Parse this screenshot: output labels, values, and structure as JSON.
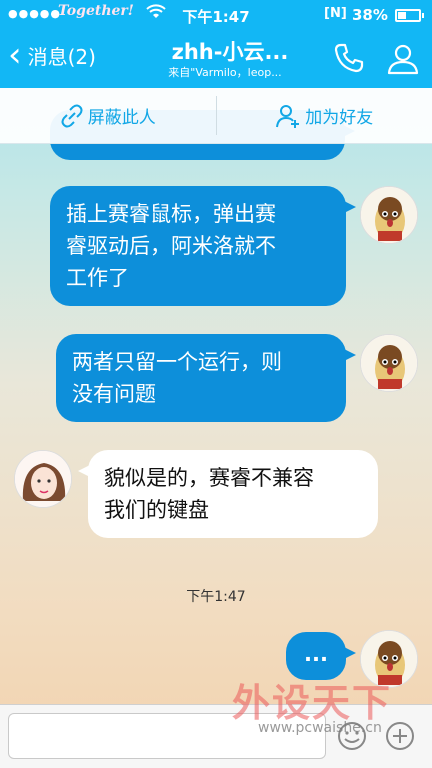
{
  "status_bar": {
    "signal": "●●●●●",
    "carrier": "Together!",
    "wifi": "wifi-icon",
    "time": "下午1:47",
    "network_badge": "[N]",
    "battery_percent": "38%"
  },
  "nav": {
    "back_label": "消息(2)",
    "title": "zhh-小云...",
    "subtitle": "来自\"Varmilo，leop...",
    "icons": [
      "phone-icon",
      "user-icon"
    ]
  },
  "actions": {
    "block_label": "屏蔽此人",
    "add_friend_label": "加为好友"
  },
  "messages": [
    {
      "from": "self",
      "text_lines": [
        "插上赛睿鼠标，弹出赛",
        "睿驱动后，阿米洛就不",
        "工作了"
      ]
    },
    {
      "from": "self",
      "text_lines": [
        "两者只留一个运行，则",
        "没有问题"
      ]
    },
    {
      "from": "other",
      "text_lines": [
        "貌似是的，赛睿不兼容",
        "我们的键盘"
      ]
    }
  ],
  "timestamp": "下午1:47",
  "typing_bubble": "...",
  "input": {
    "placeholder": ""
  },
  "watermark": {
    "logo": "外设天下",
    "url": "www.pcwaishe.cn"
  },
  "colors": {
    "accent": "#12b7f5",
    "bubble_out": "#0d8fda",
    "bubble_in": "#ffffff"
  }
}
